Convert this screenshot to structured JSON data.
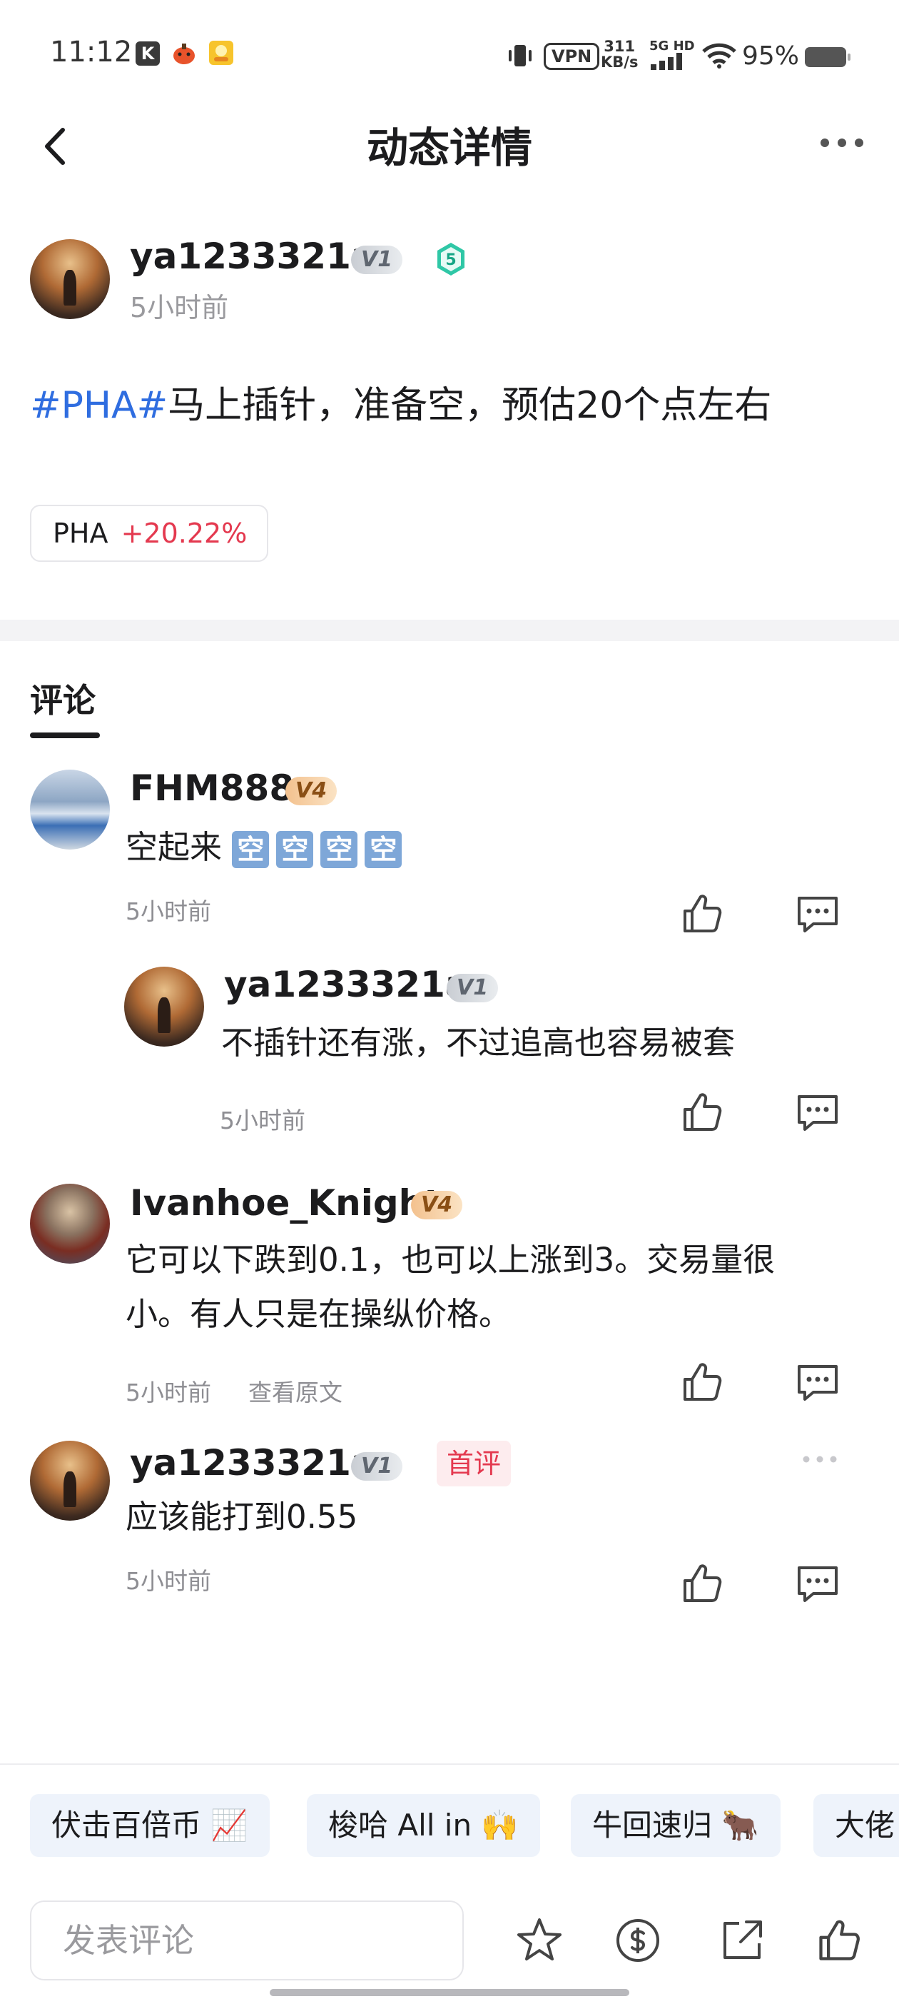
{
  "status_bar": {
    "time": "11:12",
    "app_k": "K",
    "vpn": "VPN",
    "net_speed_value": "311",
    "net_speed_unit": "KB/s",
    "network": "5G HD",
    "battery": "95%"
  },
  "header": {
    "title": "动态详情"
  },
  "post": {
    "author": "ya1233321a",
    "vip": "V1",
    "level": "5",
    "time": "5小时前",
    "hashtag": "#PHA#",
    "text": "马上插针，准备空，预估20个点左右",
    "ticker": {
      "symbol": "PHA",
      "change": "+20.22%"
    }
  },
  "comments_section": {
    "title": "评论",
    "comments": [
      {
        "author": "FHM888",
        "vip": "V4",
        "text_prefix": "空起来",
        "emoji": [
          "空",
          "空",
          "空",
          "空"
        ],
        "time": "5小时前",
        "reply": {
          "author": "ya1233321a",
          "vip": "V1",
          "text": "不插针还有涨，不过追高也容易被套",
          "time": "5小时前"
        }
      },
      {
        "author": "Ivanhoe_Knight",
        "vip": "V4",
        "text_line1": "它可以下跌到0.1，也可以上涨到3。交易量很",
        "text_line2": "小。有人只是在操纵价格。",
        "time": "5小时前",
        "view_original": "查看原文"
      },
      {
        "author": "ya1233321a",
        "vip": "V1",
        "badge": "首评",
        "text": "应该能打到0.55",
        "time": "5小时前"
      }
    ]
  },
  "quick_replies": [
    "伏击百倍币 📈",
    "梭哈 All in 🙌",
    "牛回速归 🐂",
    "大佬"
  ],
  "bottom_bar": {
    "comment_placeholder": "发表评论"
  },
  "colors": {
    "hashtag": "#2f6de0",
    "price_up": "#e4394f",
    "level_badge": "#2fc7a6"
  }
}
